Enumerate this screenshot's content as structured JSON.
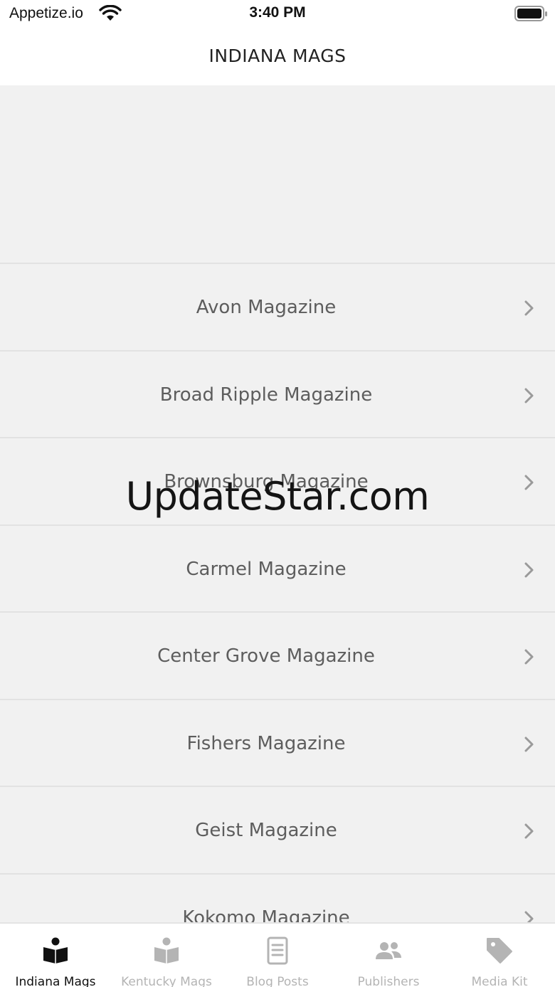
{
  "status_bar": {
    "carrier": "Appetize.io",
    "time": "3:40 PM"
  },
  "nav": {
    "title": "INDIANA MAGS"
  },
  "magazines": [
    {
      "label": "Avon Magazine"
    },
    {
      "label": "Broad Ripple Magazine"
    },
    {
      "label": "Brownsburg Magazine"
    },
    {
      "label": "Carmel Magazine"
    },
    {
      "label": "Center Grove Magazine"
    },
    {
      "label": "Fishers Magazine"
    },
    {
      "label": "Geist Magazine"
    },
    {
      "label": "Kokomo Magazine"
    }
  ],
  "watermark": "UpdateStar.com",
  "tabs": [
    {
      "label": "Indiana Mags",
      "icon": "book-reader-icon",
      "active": true
    },
    {
      "label": "Kentucky Mags",
      "icon": "book-reader-icon",
      "active": false
    },
    {
      "label": "Blog Posts",
      "icon": "document-icon",
      "active": false
    },
    {
      "label": "Publishers",
      "icon": "users-icon",
      "active": false
    },
    {
      "label": "Media Kit",
      "icon": "tag-icon",
      "active": false
    }
  ],
  "colors": {
    "active_tab": "#111111",
    "inactive_tab": "#b4b4b4",
    "list_background": "#f1f1f1"
  }
}
